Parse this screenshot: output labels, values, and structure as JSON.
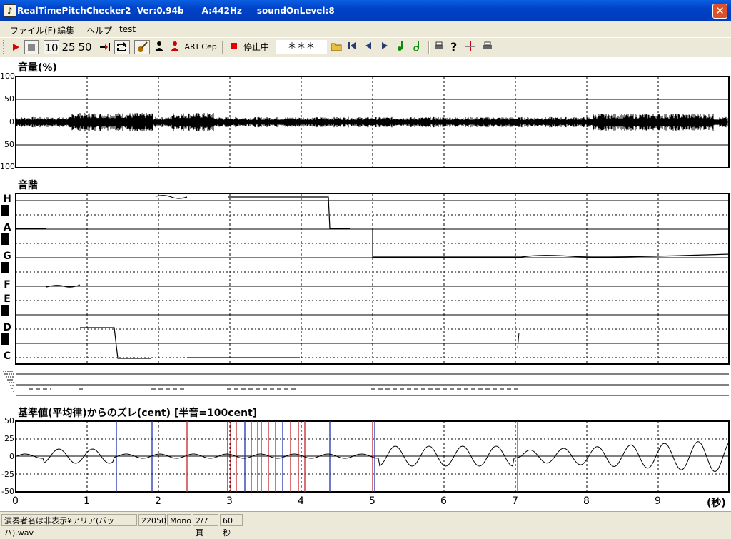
{
  "window": {
    "title": "RealTimePitchChecker2  Ver:0.94b      A:442Hz     soundOnLevel:8",
    "close_label": "✕"
  },
  "menu": [
    "ファイル(F)",
    "編集",
    "ヘルプ",
    "test"
  ],
  "toolbar": {
    "zoom_10": "10",
    "zoom_25": "25",
    "zoom_50": "50",
    "art_label": "ART",
    "cep_label": "Cep",
    "status_label": "停止中",
    "note_display": "＊＊＊"
  },
  "volume_panel": {
    "title": "音量(%)",
    "y_ticks": [
      "100",
      "50",
      "0",
      "50",
      "100"
    ]
  },
  "pitch_panel": {
    "title": "音階",
    "notes": [
      "H",
      "A",
      "G",
      "F",
      "E",
      "D",
      "C"
    ]
  },
  "deviation_panel": {
    "title": "基準値(平均律)からのズレ(cent) [半音=100cent]",
    "y_ticks": [
      "50",
      "25",
      "0",
      "-25",
      "-50"
    ]
  },
  "x_axis": {
    "ticks": [
      "0",
      "1",
      "2",
      "3",
      "4",
      "5",
      "6",
      "7",
      "8",
      "9"
    ],
    "unit": "(秒)"
  },
  "status": {
    "file": "演奏者名は非表示¥アリア(バッハ).wav",
    "rate": "22050",
    "channel": "Mono",
    "page": "2/7頁",
    "length": "60秒"
  },
  "colors": {
    "title_bar": "#0042c8",
    "deviation_blue": "#1f2fb0",
    "deviation_red": "#c0272d"
  }
}
